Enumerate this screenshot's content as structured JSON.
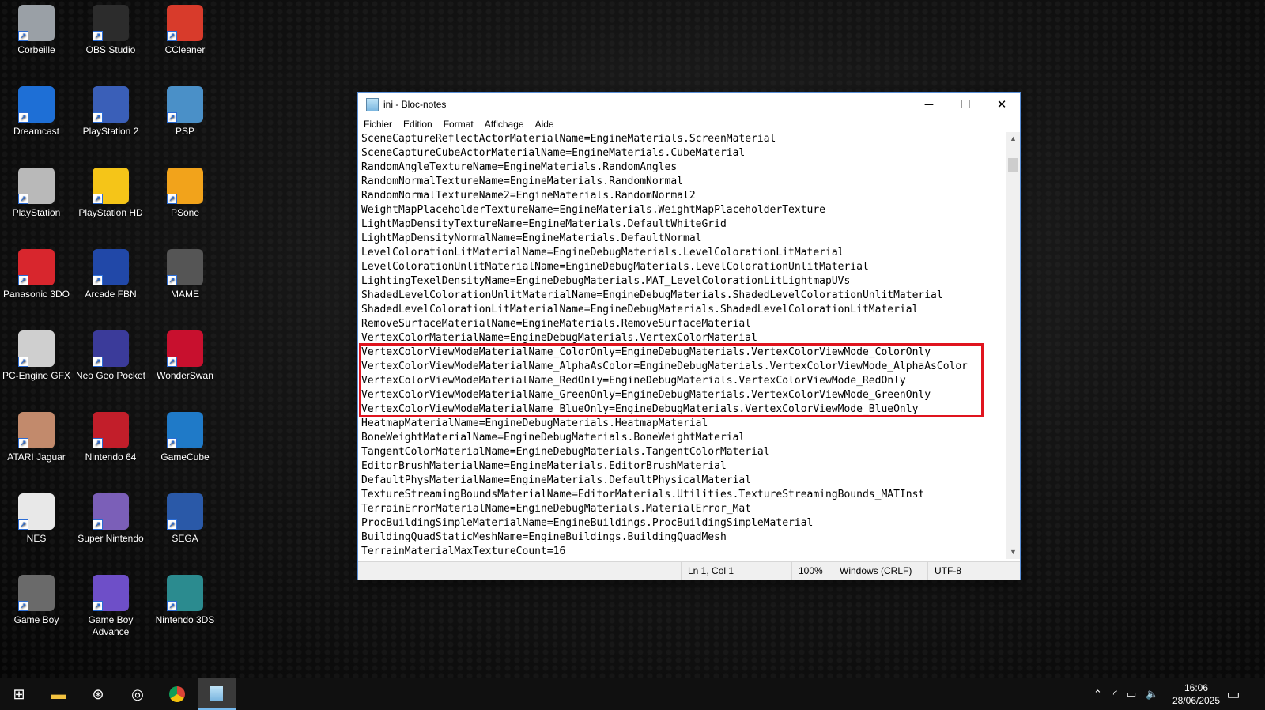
{
  "desktop": {
    "icons": [
      {
        "label": "Corbeille",
        "icon": "recycle-bin-icon"
      },
      {
        "label": "OBS Studio",
        "icon": "obs-icon"
      },
      {
        "label": "CCleaner",
        "icon": "ccleaner-icon"
      },
      {
        "label": "Dreamcast",
        "icon": "dreamcast-icon"
      },
      {
        "label": "PlayStation 2",
        "icon": "ps2-icon"
      },
      {
        "label": "PSP",
        "icon": "psp-icon"
      },
      {
        "label": "PlayStation",
        "icon": "playstation-icon"
      },
      {
        "label": "PlayStation HD",
        "icon": "star-icon"
      },
      {
        "label": "PSone",
        "icon": "psone-icon"
      },
      {
        "label": "Panasonic 3DO",
        "icon": "3do-icon"
      },
      {
        "label": "Arcade FBN",
        "icon": "fbneo-icon"
      },
      {
        "label": "MAME",
        "icon": "chip-icon"
      },
      {
        "label": "PC-Engine GFX",
        "icon": "pcengine-icon"
      },
      {
        "label": "Neo Geo Pocket",
        "icon": "neogeo-pocket-icon"
      },
      {
        "label": "WonderSwan",
        "icon": "wonderswan-icon"
      },
      {
        "label": "ATARI Jaguar",
        "icon": "jaguar-icon"
      },
      {
        "label": "Nintendo 64",
        "icon": "pj64-icon"
      },
      {
        "label": "GameCube",
        "icon": "dolphin-icon"
      },
      {
        "label": "NES",
        "icon": "eye-icon"
      },
      {
        "label": "Super Nintendo",
        "icon": "snes-icon"
      },
      {
        "label": "SEGA",
        "icon": "kega-icon"
      },
      {
        "label": "Game Boy",
        "icon": "gameboy-icon"
      },
      {
        "label": "Game Boy Advance",
        "icon": "gba-icon"
      },
      {
        "label": "Nintendo 3DS",
        "icon": "3ds-icon"
      }
    ]
  },
  "window": {
    "title": "ini - Bloc-notes",
    "minimize": "─",
    "maximize": "☐",
    "close": "✕",
    "menu": [
      "Fichier",
      "Edition",
      "Format",
      "Affichage",
      "Aide"
    ],
    "lines": [
      "SceneCaptureReflectActorMaterialName=EngineMaterials.ScreenMaterial",
      "SceneCaptureCubeActorMaterialName=EngineMaterials.CubeMaterial",
      "RandomAngleTextureName=EngineMaterials.RandomAngles",
      "RandomNormalTextureName=EngineMaterials.RandomNormal",
      "RandomNormalTextureName2=EngineMaterials.RandomNormal2",
      "WeightMapPlaceholderTextureName=EngineMaterials.WeightMapPlaceholderTexture",
      "LightMapDensityTextureName=EngineMaterials.DefaultWhiteGrid",
      "LightMapDensityNormalName=EngineMaterials.DefaultNormal",
      "LevelColorationLitMaterialName=EngineDebugMaterials.LevelColorationLitMaterial",
      "LevelColorationUnlitMaterialName=EngineDebugMaterials.LevelColorationUnlitMaterial",
      "LightingTexelDensityName=EngineDebugMaterials.MAT_LevelColorationLitLightmapUVs",
      "ShadedLevelColorationUnlitMaterialName=EngineDebugMaterials.ShadedLevelColorationUnlitMaterial",
      "ShadedLevelColorationLitMaterialName=EngineDebugMaterials.ShadedLevelColorationLitMaterial",
      "RemoveSurfaceMaterialName=EngineMaterials.RemoveSurfaceMaterial",
      "VertexColorMaterialName=EngineDebugMaterials.VertexColorMaterial",
      "VertexColorViewModeMaterialName_ColorOnly=EngineDebugMaterials.VertexColorViewMode_ColorOnly",
      "VertexColorViewModeMaterialName_AlphaAsColor=EngineDebugMaterials.VertexColorViewMode_AlphaAsColor",
      "VertexColorViewModeMaterialName_RedOnly=EngineDebugMaterials.VertexColorViewMode_RedOnly",
      "VertexColorViewModeMaterialName_GreenOnly=EngineDebugMaterials.VertexColorViewMode_GreenOnly",
      "VertexColorViewModeMaterialName_BlueOnly=EngineDebugMaterials.VertexColorViewMode_BlueOnly",
      "HeatmapMaterialName=EngineDebugMaterials.HeatmapMaterial",
      "BoneWeightMaterialName=EngineDebugMaterials.BoneWeightMaterial",
      "TangentColorMaterialName=EngineDebugMaterials.TangentColorMaterial",
      "EditorBrushMaterialName=EngineMaterials.EditorBrushMaterial",
      "DefaultPhysMaterialName=EngineMaterials.DefaultPhysicalMaterial",
      "TextureStreamingBoundsMaterialName=EditorMaterials.Utilities.TextureStreamingBounds_MATInst",
      "TerrainErrorMaterialName=EngineDebugMaterials.MaterialError_Mat",
      "ProcBuildingSimpleMaterialName=EngineBuildings.ProcBuildingSimpleMaterial",
      "BuildingQuadStaticMeshName=EngineBuildings.BuildingQuadMesh",
      "TerrainMaterialMaxTextureCount=16"
    ],
    "status": {
      "position": "Ln 1, Col 1",
      "zoom": "100%",
      "line_ending": "Windows (CRLF)",
      "encoding": "UTF-8"
    }
  },
  "taskbar": {
    "items": [
      "start-icon",
      "file-explorer-icon",
      "retroarch-icon",
      "obs-icon",
      "chrome-icon",
      "notepad-icon"
    ],
    "time": "16:06",
    "date": "28/06/2025"
  },
  "colors": {
    "highlight": "#e0141e"
  }
}
